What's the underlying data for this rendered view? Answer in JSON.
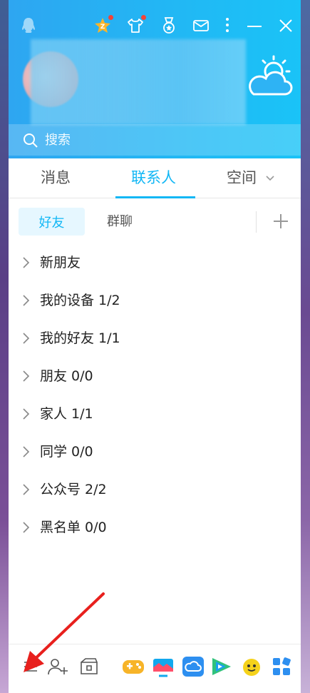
{
  "search": {
    "placeholder": "搜索"
  },
  "tabs": [
    {
      "label": "消息"
    },
    {
      "label": "联系人",
      "active": true
    },
    {
      "label": "空间"
    }
  ],
  "subtabs": {
    "friends": "好友",
    "groups": "群聊"
  },
  "contacts": [
    {
      "label": "新朋友"
    },
    {
      "label": "我的设备 1/2"
    },
    {
      "label": "我的好友 1/1"
    },
    {
      "label": "朋友 0/0"
    },
    {
      "label": "家人 1/1"
    },
    {
      "label": "同学 0/0"
    },
    {
      "label": "公众号 2/2"
    },
    {
      "label": "黑名单 0/0"
    }
  ],
  "icons": {
    "titlebar": [
      "qq-logo-icon",
      "vip-star-icon",
      "shirt-icon",
      "medal-icon",
      "mail-icon",
      "more-icon",
      "minimize-icon",
      "close-icon"
    ],
    "bottom": [
      "menu-icon",
      "add-contact-icon",
      "app-manager-icon",
      "game-icon",
      "live-icon",
      "weiyun-icon",
      "tencent-video-icon",
      "baidu-icon",
      "apps-icon"
    ]
  },
  "colors": {
    "accent": "#12b7f5",
    "header_start": "#2ea6f1",
    "header_end": "#1ac3f7",
    "annotation_arrow": "#e8201d"
  }
}
